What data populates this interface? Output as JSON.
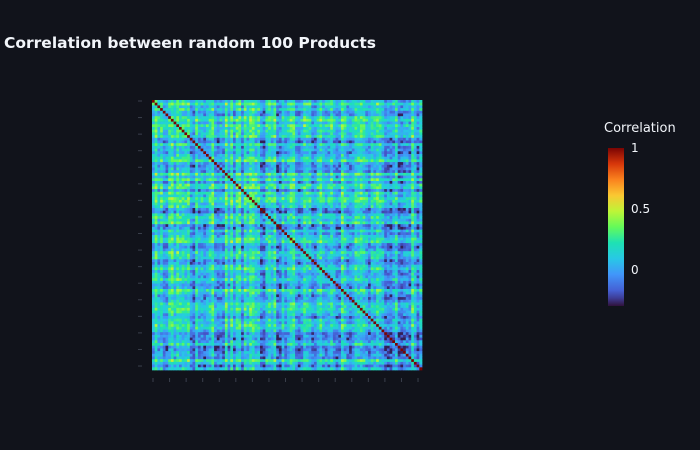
{
  "chart_data": {
    "type": "heatmap",
    "title": "Correlation between random 100 Products",
    "xlabel": "",
    "ylabel": "",
    "size": 100,
    "diagonal_value": 1,
    "value_range": [
      -0.3,
      1
    ],
    "colorscale": "turbo",
    "colorbar": {
      "title": "Correlation",
      "ticks": [
        {
          "value": 1,
          "label": "1"
        },
        {
          "value": 0.5,
          "label": "0.5"
        },
        {
          "value": 0,
          "label": "0"
        }
      ]
    },
    "grid": false,
    "legend_placement": "right"
  },
  "colors": {
    "background": "#11131b",
    "text": "#f2f5fa"
  }
}
